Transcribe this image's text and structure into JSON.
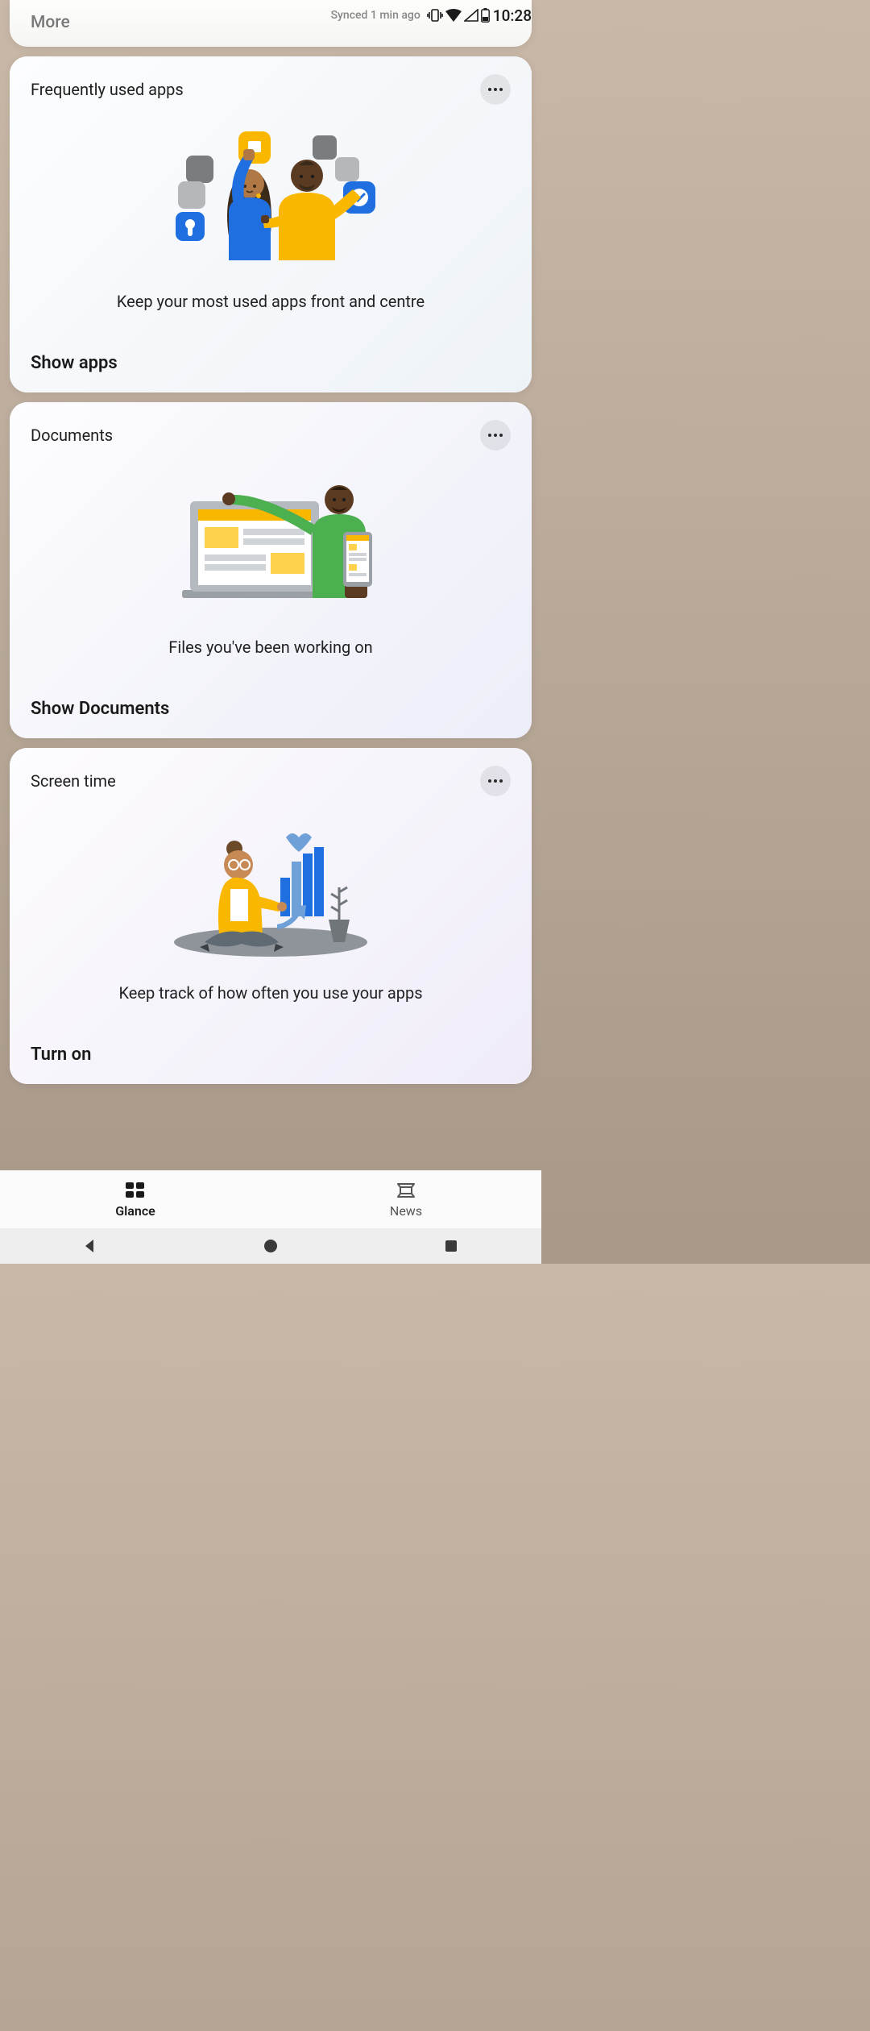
{
  "status": {
    "sync_text": "Synced 1 min ago",
    "time": "10:28"
  },
  "more_card": {
    "label": "More"
  },
  "cards": [
    {
      "title": "Frequently used apps",
      "desc": "Keep your most used apps front and centre",
      "action": "Show apps"
    },
    {
      "title": "Documents",
      "desc": "Files you've been working on",
      "action": "Show Documents"
    },
    {
      "title": "Screen time",
      "desc": "Keep track of how often you use your apps",
      "action": "Turn on"
    }
  ],
  "tabs": {
    "glance": "Glance",
    "news": "News"
  }
}
